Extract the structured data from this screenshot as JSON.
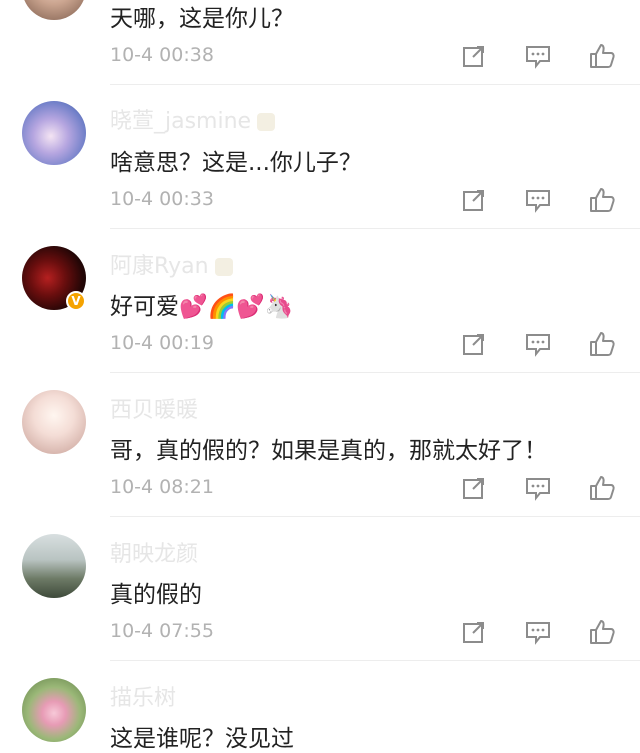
{
  "comments": [
    {
      "username": "",
      "text": "天哪，这是你儿？",
      "time": "10-4 00:38"
    },
    {
      "username": "晓萱_jasmine",
      "text": "啥意思？这是...你儿子？",
      "time": "10-4 00:33"
    },
    {
      "username": "阿康Ryan",
      "text": "好可爱💕🌈💕🦄",
      "time": "10-4 00:19",
      "verified": "V"
    },
    {
      "username": "西贝暖暖",
      "text": "哥，真的假的？如果是真的，那就太好了！",
      "time": "10-4 08:21"
    },
    {
      "username": "朝映龙颜",
      "text": "真的假的",
      "time": "10-4 07:55"
    },
    {
      "username": "描乐树",
      "text": "这是谁呢？没见过",
      "time": ""
    }
  ],
  "icons": {
    "share": "share-icon",
    "reply": "comment-icon",
    "like": "thumbs-up-icon"
  },
  "colors": {
    "name": "#e6e6e6",
    "text": "#222222",
    "time": "#b2b2b2",
    "icon": "#8c8c8c",
    "badge": "#f5a300"
  }
}
